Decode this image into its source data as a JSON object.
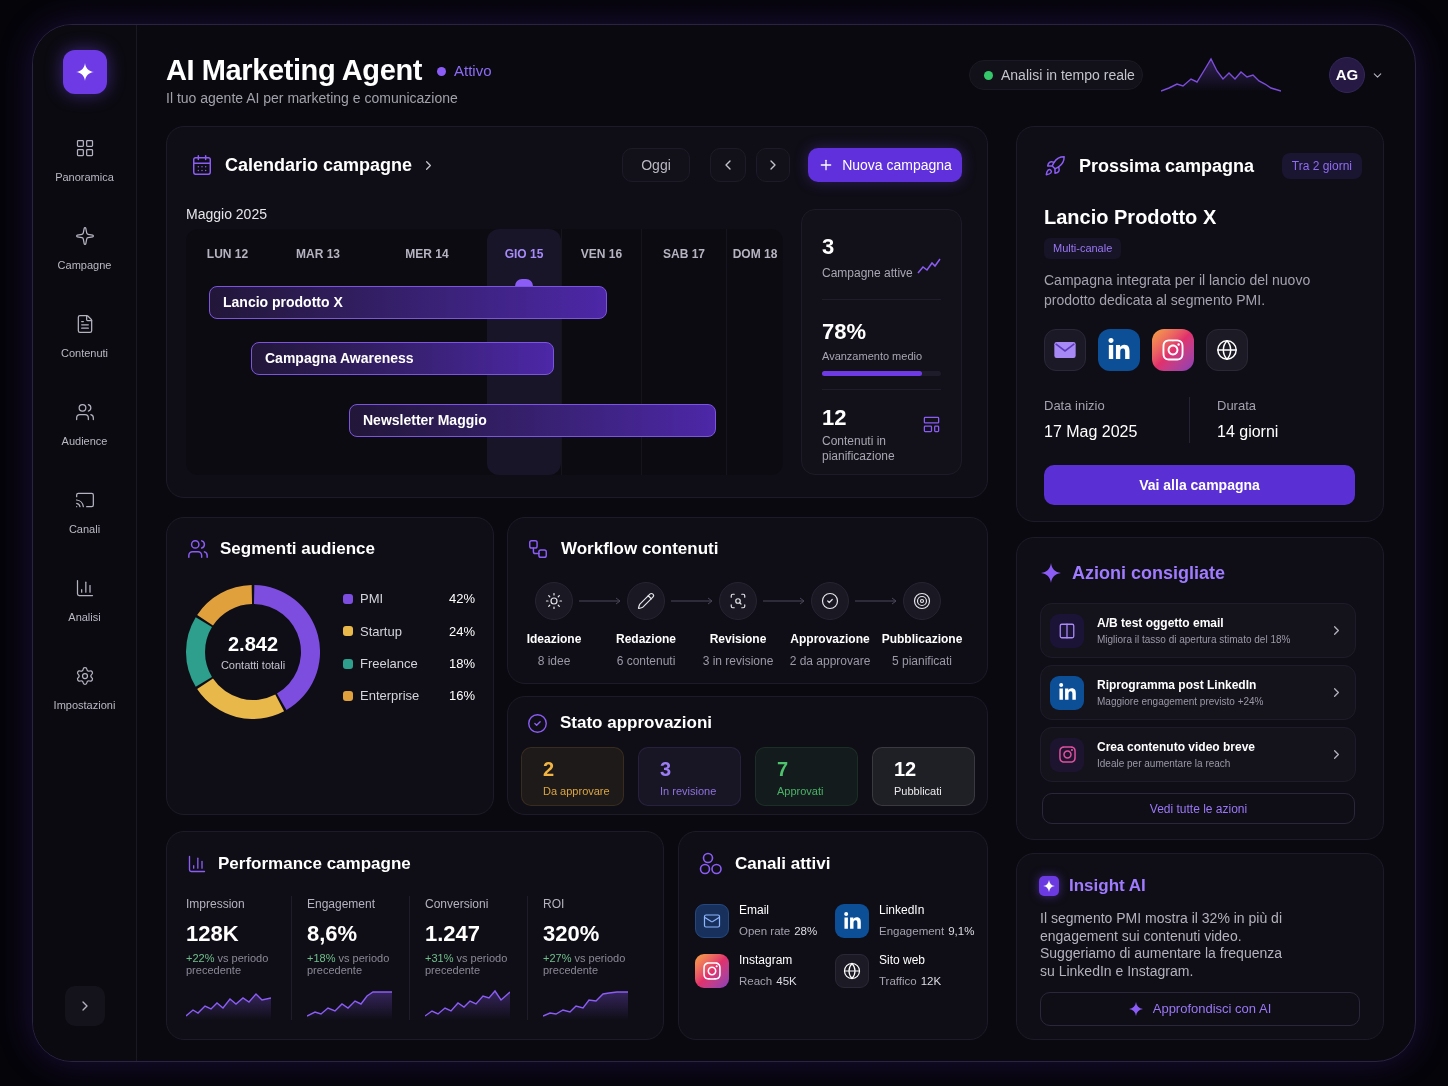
{
  "sidebar": {
    "items": [
      {
        "kind": "overview",
        "label": "Panoramica"
      },
      {
        "kind": "campaigns",
        "label": "Campagne"
      },
      {
        "kind": "content",
        "label": "Contenuti"
      },
      {
        "kind": "audience",
        "label": "Audience"
      },
      {
        "kind": "channels",
        "label": "Canali"
      },
      {
        "kind": "analytics",
        "label": "Analisi"
      },
      {
        "kind": "settings",
        "label": "Impostazioni"
      }
    ]
  },
  "header": {
    "title": "AI Marketing Agent",
    "status": "Attivo",
    "subtitle": "Il tuo agente AI per marketing e comunicazione",
    "live_label": "Analisi in tempo reale",
    "avatar": "AG"
  },
  "calendar": {
    "title": "Calendario campagne",
    "today_button": "Oggi",
    "new_button": "Nuova campagna",
    "month": "Maggio 2025",
    "days": [
      {
        "label": "LUN 12",
        "selected": false
      },
      {
        "label": "MAR 13",
        "selected": false
      },
      {
        "label": "MER 14",
        "selected": false
      },
      {
        "label": "GIO 15",
        "selected": true
      },
      {
        "label": "VEN 16",
        "selected": false
      },
      {
        "label": "SAB 17",
        "selected": false
      },
      {
        "label": "DOM 18",
        "selected": false
      }
    ],
    "events": [
      {
        "label": "Lancio prodotto X"
      },
      {
        "label": "Campagna Awareness"
      },
      {
        "label": "Newsletter Maggio"
      }
    ],
    "stats": [
      {
        "kind": "trend",
        "value": "3",
        "label": "Campagne attive"
      },
      {
        "kind": "progress",
        "value": "78%",
        "label": "Avanzamento medio",
        "level": 0.84
      },
      {
        "kind": "planning",
        "value": "12",
        "label": "Contenuti in pianificazione"
      }
    ]
  },
  "next_campaign": {
    "title": "Prossima campagna",
    "badge": "Tra 2 giorni",
    "name": "Lancio Prodotto X",
    "tag": "Multi-canale",
    "description": "Campagna integrata per il lancio del nuovo prodotto dedicata al segmento PMI.",
    "channels": [
      {
        "kind": "email"
      },
      {
        "kind": "linkedin"
      },
      {
        "kind": "instagram"
      },
      {
        "kind": "web"
      }
    ],
    "start_label": "Data inizio",
    "start_value": "17 Mag 2025",
    "duration_label": "Durata",
    "duration_value": "14 giorni",
    "button": "Vai alla campagna"
  },
  "audience": {
    "title": "Segmenti audience",
    "total": "2.842",
    "total_label": "Contatti totali",
    "legend": [
      {
        "share": "42%",
        "color": "#7c4dde"
      },
      {
        "share": "24%",
        "color": "#e8b84a"
      },
      {
        "share": "18%",
        "color": "#2d9f8c"
      },
      {
        "share": "16%",
        "color": "#e0a13c"
      }
    ],
    "chart_data": {
      "type": "donut",
      "categories": [
        "PMI",
        "Startup",
        "Freelance",
        "Enterprise"
      ],
      "values": [
        42,
        24,
        18,
        16
      ],
      "legend": "right"
    }
  },
  "workflow": {
    "title": "Workflow contenuti",
    "steps": [
      {
        "kind": "idea",
        "label": "Ideazione",
        "detail": "8 idee"
      },
      {
        "kind": "edit",
        "label": "Redazione",
        "detail": "6 contenuti"
      },
      {
        "kind": "review",
        "label": "Revisione",
        "detail": "3 in revisione"
      },
      {
        "kind": "approve",
        "label": "Approvazione",
        "detail": "2 da approvare"
      },
      {
        "kind": "publish",
        "label": "Pubblicazione",
        "detail": "5 pianificati"
      }
    ]
  },
  "approvals": {
    "title": "Stato approvazioni",
    "items": [
      {
        "value": "2",
        "label": "Da approvare",
        "color": "#f0b445"
      },
      {
        "value": "3",
        "label": "In revisione",
        "color": "#9b7cf3"
      },
      {
        "value": "7",
        "label": "Approvati",
        "color": "#4fc26e"
      },
      {
        "value": "12",
        "label": "Pubblicati",
        "color": "#ffffff"
      }
    ]
  },
  "actions": {
    "title": "Azioni consigliate",
    "items": [
      {
        "kind": "abtest",
        "title": "A/B test oggetto email",
        "description": "Migliora il tasso di apertura stimato del 18%"
      },
      {
        "kind": "linkedin",
        "title": "Riprogramma post LinkedIn",
        "description": "Maggiore engagement previsto +24%"
      },
      {
        "kind": "instagram",
        "title": "Crea contenuto video breve",
        "description": "Ideale per aumentare la reach"
      }
    ],
    "button": "Vedi tutte le azioni"
  },
  "performance": {
    "title": "Performance campagne",
    "metrics": [
      {
        "label": "Impression",
        "value": "128K",
        "change": "**+22%** vs periodo precedente"
      },
      {
        "label": "Engagement",
        "value": "8,6%",
        "change": "**+18%** vs periodo precedente"
      },
      {
        "label": "Conversioni",
        "value": "1.247",
        "change": "**+31%** vs periodo precedente"
      },
      {
        "label": "ROI",
        "value": "320%",
        "change": "**+27%** vs periodo precedente"
      }
    ]
  },
  "channels": {
    "title": "Canali attivi",
    "items": [
      {
        "kind": "email",
        "name": "Email",
        "metric": "Open rate",
        "value": "28%"
      },
      {
        "kind": "linkedin",
        "name": "LinkedIn",
        "metric": "Engagement",
        "value": "9,1%"
      },
      {
        "kind": "instagram",
        "name": "Instagram",
        "metric": "Reach",
        "value": "45K"
      },
      {
        "kind": "web",
        "name": "Sito web",
        "metric": "Traffico",
        "value": "12K"
      }
    ]
  },
  "insight": {
    "title": "Insight AI",
    "text": "Il segmento PMI mostra il 32% in più di engagement sui contenuti video. Suggeriamo di aumentare la frequenza su LinkedIn e Instagram.",
    "button": "Approfondisci con AI"
  }
}
